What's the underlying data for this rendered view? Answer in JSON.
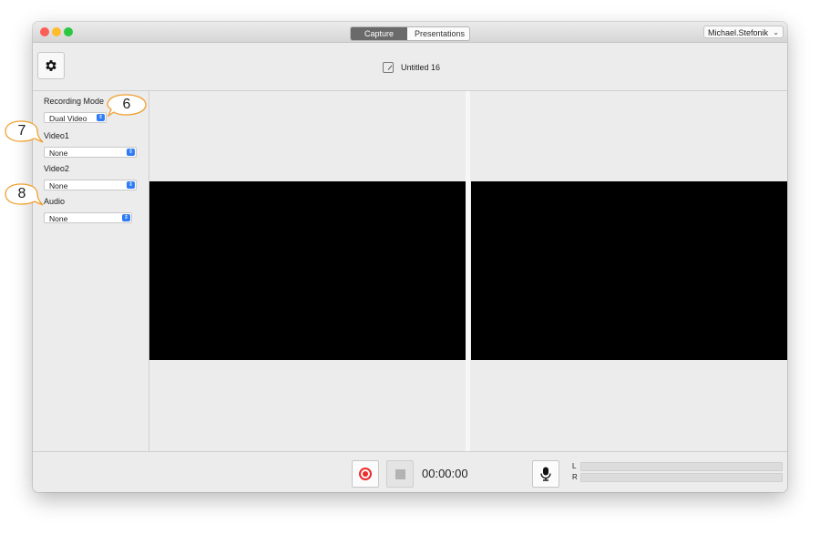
{
  "titlebar": {
    "tabs": [
      {
        "label": "Capture",
        "active": true
      },
      {
        "label": "Presentations",
        "active": false
      }
    ],
    "user": "Michael.Stefonik",
    "user_chevron": "⌄"
  },
  "toolbar": {
    "settings_icon": "gear-icon",
    "document_title": "Untitled 16"
  },
  "sidebar": {
    "recording_mode": {
      "label": "Recording Mode",
      "value": "Dual Video"
    },
    "video1": {
      "label": "Video1",
      "value": "None"
    },
    "video2": {
      "label": "Video2",
      "value": "None"
    },
    "audio": {
      "label": "Audio",
      "value": "None"
    }
  },
  "controls": {
    "timer": "00:00:00",
    "meter_left_label": "L",
    "meter_right_label": "R"
  },
  "callouts": [
    "6",
    "7",
    "8"
  ],
  "colors": {
    "record": "#ef2b2b",
    "popup_arrow": "#2f7cf6",
    "callout_border": "#f0a030"
  }
}
